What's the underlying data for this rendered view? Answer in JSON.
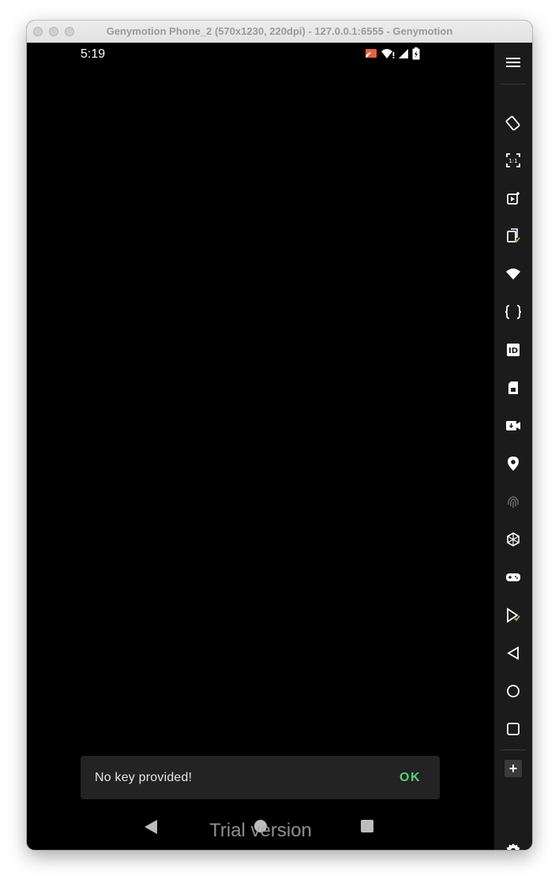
{
  "window": {
    "title": "Genymotion Phone_2 (570x1230, 220dpi) - 127.0.0.1:6555 - Genymotion"
  },
  "status_bar": {
    "time": "5:19",
    "icons": [
      "cast-icon",
      "wifi-alert-icon",
      "cell-signal-icon",
      "battery-charging-icon"
    ]
  },
  "snackbar": {
    "message": "No key provided!",
    "action_label": "OK",
    "action_color": "#56d174"
  },
  "navbar": {
    "buttons": [
      "back",
      "home",
      "recents"
    ]
  },
  "watermark": "Trial version",
  "sidebar": {
    "tools": [
      "menu-icon",
      "rotate-icon",
      "pixel-perfect-icon",
      "screen-capture-icon",
      "clipboard-icon",
      "wifi-icon",
      "json-icon",
      "device-id-icon",
      "sim-card-icon",
      "camera-icon",
      "gps-icon",
      "fingerprint-icon",
      "motion-sensor-icon",
      "gamepad-icon",
      "play-store-icon",
      "back-icon",
      "home-icon",
      "recents-icon",
      "add-icon",
      "settings-icon"
    ],
    "add_label": "+"
  }
}
